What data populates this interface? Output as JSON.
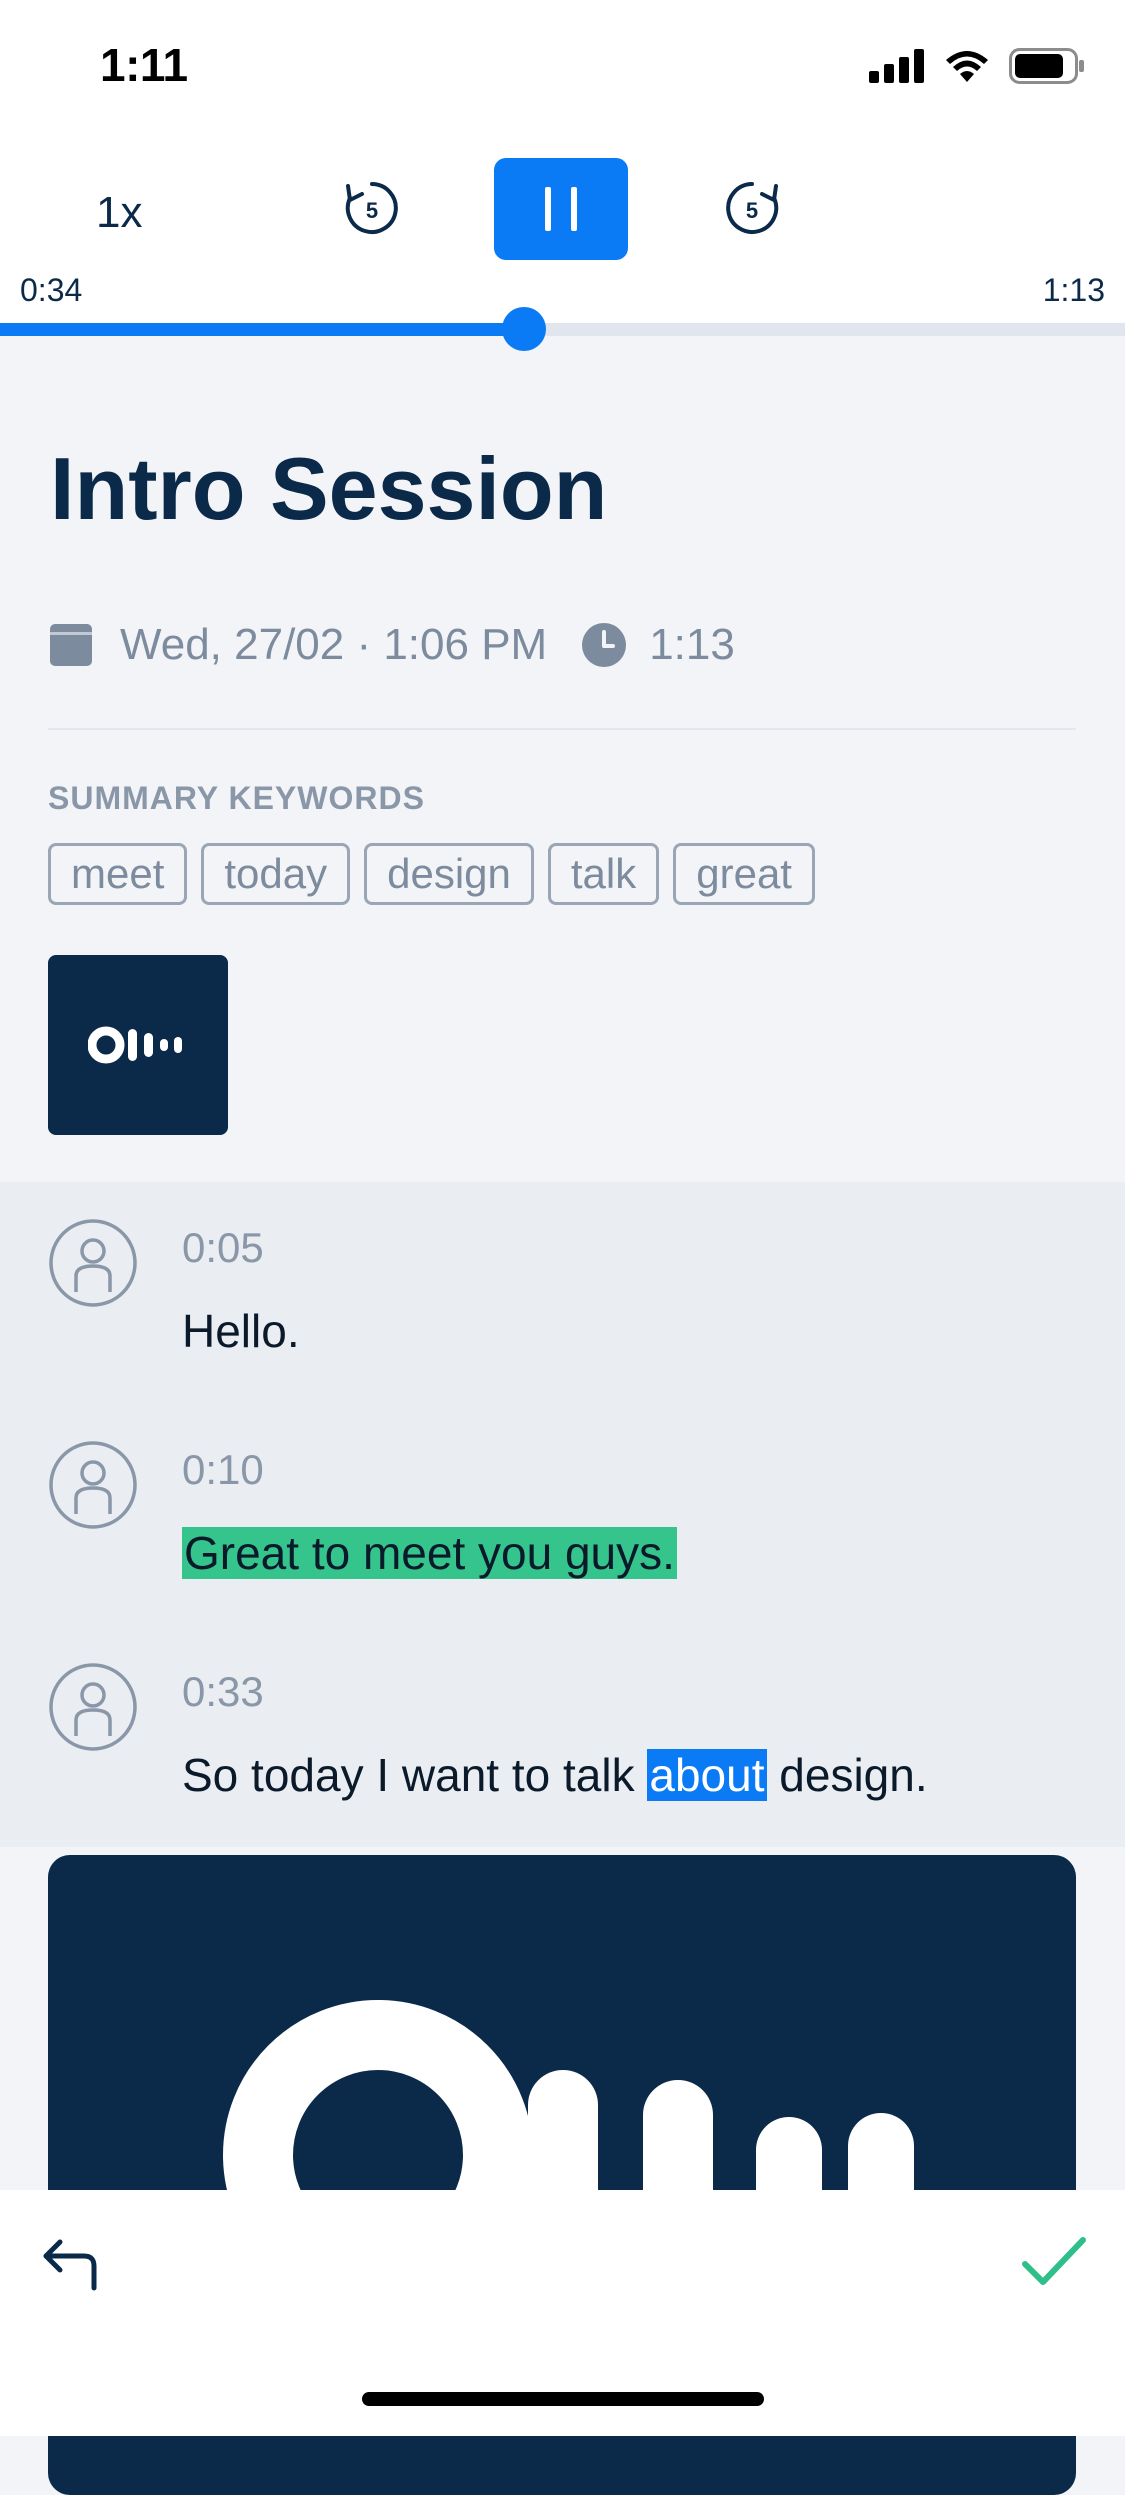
{
  "status_bar": {
    "time": "1:11"
  },
  "player": {
    "speed_label": "1x",
    "rewind_seconds": "5",
    "forward_seconds": "5",
    "current_time": "0:34",
    "total_time": "1:13",
    "progress_fraction": 0.466
  },
  "session": {
    "title": "Intro Session",
    "date": "Wed, 27/02 · 1:06 PM",
    "duration": "1:13"
  },
  "keywords": {
    "label": "SUMMARY KEYWORDS",
    "items": [
      "meet",
      "today",
      "design",
      "talk",
      "great"
    ]
  },
  "transcript": [
    {
      "time": "0:05",
      "text": "Hello."
    },
    {
      "time": "0:10",
      "text": "Great to meet you guys."
    },
    {
      "time": "0:33",
      "text_before": "So today I want to talk ",
      "text_highlight": "about",
      "text_after": " design."
    }
  ],
  "colors": {
    "accent": "#0a7af5",
    "navy": "#0b2a4a",
    "highlight_green": "#35c48b",
    "check_green": "#2fbf8a"
  }
}
